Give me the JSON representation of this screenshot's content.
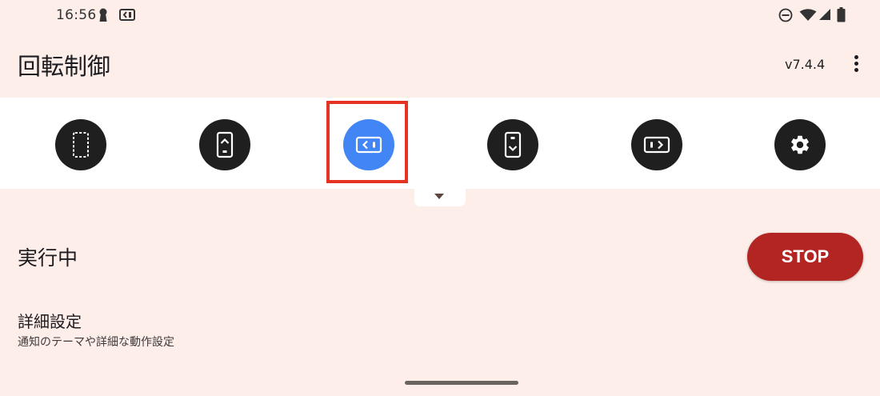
{
  "status_bar": {
    "time": "16:56",
    "left_icons": [
      "keyhole-icon",
      "rotation-app-icon"
    ],
    "right_icons": [
      "do-not-disturb-icon",
      "wifi-icon",
      "signal-icon",
      "battery-icon"
    ]
  },
  "app_bar": {
    "title": "回転制御",
    "version": "v7.4.4",
    "menu_icon": "more-vert-icon"
  },
  "toolbar": {
    "buttons": [
      {
        "icon": "free-rotation-icon",
        "selected": false
      },
      {
        "icon": "portrait-icon",
        "selected": false
      },
      {
        "icon": "landscape-icon",
        "selected": true
      },
      {
        "icon": "reverse-portrait-icon",
        "selected": false
      },
      {
        "icon": "reverse-landscape-icon",
        "selected": false
      },
      {
        "icon": "settings-icon",
        "selected": false
      }
    ],
    "expand_icon": "arrow-drop-down-icon"
  },
  "status": {
    "label": "実行中",
    "stop_label": "STOP"
  },
  "settings": {
    "title": "詳細設定",
    "subtitle": "通知のテーマや詳細な動作設定"
  },
  "colors": {
    "background": "#fdeee9",
    "toolbar": "#ffffff",
    "button_dark": "#1f1f1f",
    "button_active": "#4285f4",
    "highlight": "#e53223",
    "stop": "#b32522"
  }
}
